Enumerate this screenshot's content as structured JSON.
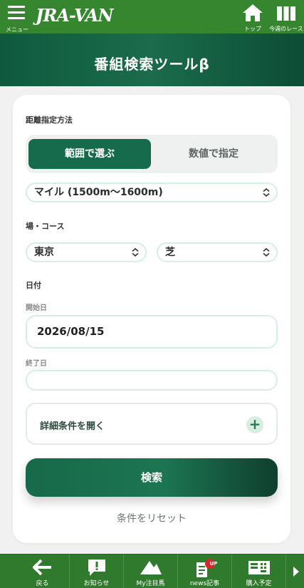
{
  "header": {
    "menu_label": "メニュー",
    "logo": "JRA-VAN",
    "home_label": "トップ",
    "race_label": "今週のレース"
  },
  "page": {
    "title": "番組検索ツールβ"
  },
  "form": {
    "distance_section": "距離指定方法",
    "seg_range": "範囲で選ぶ",
    "seg_value": "数値で指定",
    "distance_select": "マイル (1500m〜1600m)",
    "venue_section": "場・コース",
    "venue_select": "東京",
    "course_select": "芝",
    "date_section": "日付",
    "start_label": "開始日",
    "start_value": "2026/08/15",
    "end_label": "終了日",
    "end_value": "",
    "details_label": "詳細条件を開く",
    "search_button": "検索",
    "reset_link": "条件をリセット"
  },
  "bottom_nav": {
    "back": "戻る",
    "news_notice": "お知らせ",
    "my_horses": "My注目馬",
    "news_articles": "news記事",
    "news_badge": "UP",
    "purchase": "購入予定"
  },
  "colors": {
    "brand_green": "#35862f",
    "title_green": "#166b4d",
    "badge_red": "#d02a2a"
  }
}
